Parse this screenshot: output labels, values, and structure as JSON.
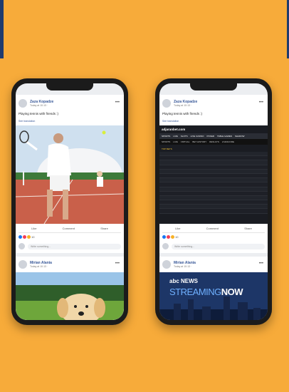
{
  "left_phone": {
    "post1": {
      "user": "Zaza Kopadze",
      "time": "Today at 10:13 · ",
      "text": "Playing tennis with friends :)",
      "translate": "See translation",
      "actions": [
        "Like",
        "Comment",
        "Share"
      ],
      "reactions": "10",
      "comment_placeholder": "Write something..."
    },
    "post2": {
      "user": "Mirian Alania",
      "time": "Today at 10:13 · "
    }
  },
  "right_phone": {
    "post1": {
      "user": "Zaza Kopadze",
      "time": "Today at 10:13 · ",
      "text": "Playing tennis with friends :)",
      "translate": "See translation",
      "actions": [
        "Like",
        "Comment",
        "Share"
      ],
      "reactions": "10",
      "comment_placeholder": "Write something..."
    },
    "post2": {
      "user": "Mirian Alania",
      "time": "Today at 10:13 · "
    },
    "bet": {
      "logo": "adjaranbet.com",
      "nav": [
        "SPORTS",
        "LIVE",
        "SLOTS",
        "LIVE CASINO",
        "POKER",
        "TABLE GAMES",
        "SHADOW"
      ],
      "nav2": [
        "SPORTS",
        "LIVE",
        "VIRTUAL",
        "BET HISTORY",
        "RESULTS",
        "LIVESCORE"
      ],
      "section": "TOP BETS"
    },
    "news": {
      "brand": "abc NEWS",
      "stream1": "STREAMING",
      "stream2": "NOW"
    }
  }
}
